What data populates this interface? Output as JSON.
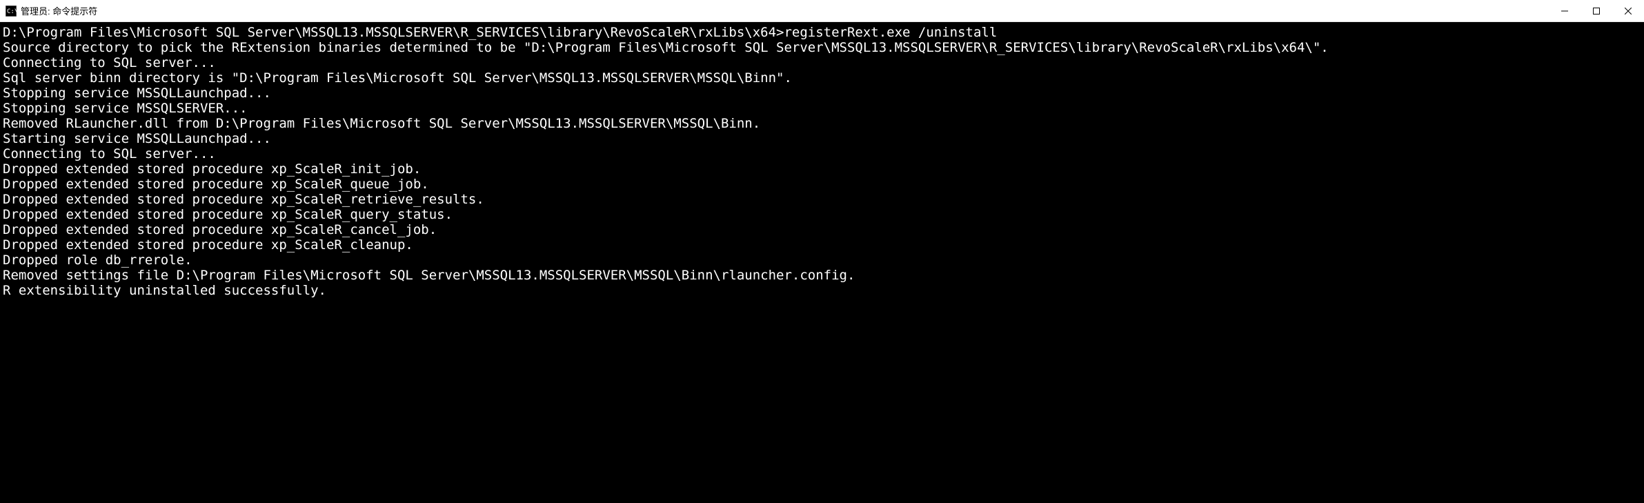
{
  "window": {
    "title": "管理员: 命令提示符"
  },
  "terminal": {
    "lines": [
      "",
      "D:\\Program Files\\Microsoft SQL Server\\MSSQL13.MSSQLSERVER\\R_SERVICES\\library\\RevoScaleR\\rxLibs\\x64>registerRext.exe /uninstall",
      "Source directory to pick the RExtension binaries determined to be \"D:\\Program Files\\Microsoft SQL Server\\MSSQL13.MSSQLSERVER\\R_SERVICES\\library\\RevoScaleR\\rxLibs\\x64\\\".",
      "Connecting to SQL server...",
      "Sql server binn directory is \"D:\\Program Files\\Microsoft SQL Server\\MSSQL13.MSSQLSERVER\\MSSQL\\Binn\".",
      "Stopping service MSSQLLaunchpad...",
      "Stopping service MSSQLSERVER...",
      "Removed RLauncher.dll from D:\\Program Files\\Microsoft SQL Server\\MSSQL13.MSSQLSERVER\\MSSQL\\Binn.",
      "Starting service MSSQLLaunchpad...",
      "Connecting to SQL server...",
      "Dropped extended stored procedure xp_ScaleR_init_job.",
      "Dropped extended stored procedure xp_ScaleR_queue_job.",
      "Dropped extended stored procedure xp_ScaleR_retrieve_results.",
      "Dropped extended stored procedure xp_ScaleR_query_status.",
      "Dropped extended stored procedure xp_ScaleR_cancel_job.",
      "Dropped extended stored procedure xp_ScaleR_cleanup.",
      "Dropped role db_rrerole.",
      "Removed settings file D:\\Program Files\\Microsoft SQL Server\\MSSQL13.MSSQLSERVER\\MSSQL\\Binn\\rlauncher.config.",
      "R extensibility uninstalled successfully."
    ]
  }
}
